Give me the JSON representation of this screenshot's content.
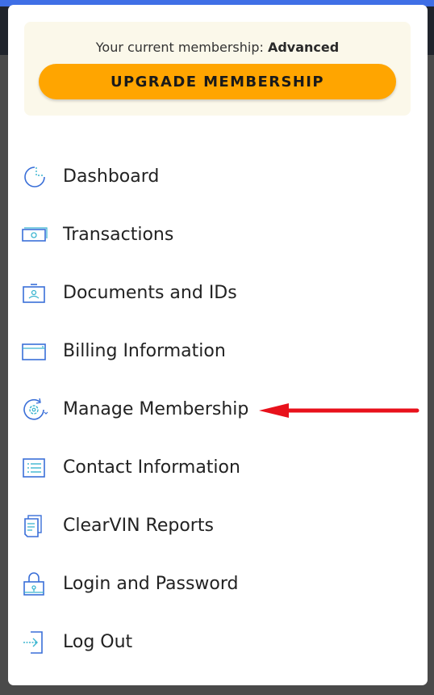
{
  "membership": {
    "prefix": "Your current membership: ",
    "level": "Advanced",
    "upgrade_label": "UPGRADE MEMBERSHIP"
  },
  "colors": {
    "accent": "#ffa500",
    "icon_blue": "#3a6fd8",
    "icon_teal": "#3bb5d0",
    "annotation_arrow": "#e8111b"
  },
  "menu": {
    "items": [
      {
        "label": "Dashboard",
        "icon": "dashboard-pie-icon"
      },
      {
        "label": "Transactions",
        "icon": "money-bill-icon"
      },
      {
        "label": "Documents and IDs",
        "icon": "id-card-icon"
      },
      {
        "label": "Billing Information",
        "icon": "credit-card-icon"
      },
      {
        "label": "Manage Membership",
        "icon": "gear-refresh-icon"
      },
      {
        "label": "Contact Information",
        "icon": "list-icon"
      },
      {
        "label": "ClearVIN Reports",
        "icon": "reports-stack-icon"
      },
      {
        "label": "Login and Password",
        "icon": "lock-icon"
      },
      {
        "label": "Log Out",
        "icon": "logout-icon"
      }
    ]
  }
}
